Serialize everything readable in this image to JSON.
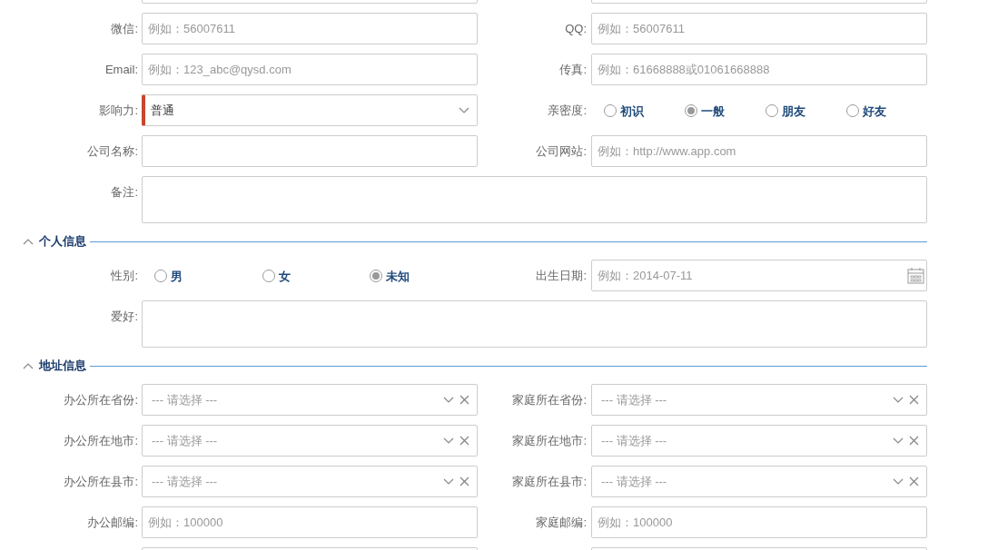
{
  "rows": [
    {
      "kind": "pair",
      "left": {
        "kind": "select"
      },
      "right": {
        "kind": "text"
      }
    },
    {
      "kind": "pair",
      "left": {
        "label": "微信:",
        "kind": "text",
        "placeholder": "例如：56007611"
      },
      "right": {
        "label": "QQ:",
        "kind": "text",
        "placeholder": "例如：56007611"
      }
    },
    {
      "kind": "pair",
      "left": {
        "label": "Email:",
        "kind": "text",
        "placeholder": "例如：123_abc@qysd.com"
      },
      "right": {
        "label": "传真:",
        "kind": "text",
        "placeholder": "例如：61668888或01061668888"
      }
    },
    {
      "kind": "pair",
      "left": {
        "label": "影响力:",
        "kind": "select",
        "value": "普通",
        "required": true
      },
      "right": {
        "label": "亲密度:",
        "kind": "radio",
        "options": [
          {
            "label": "初识",
            "selected": false
          },
          {
            "label": "一般",
            "selected": true
          },
          {
            "label": "朋友",
            "selected": false
          },
          {
            "label": "好友",
            "selected": false
          }
        ]
      }
    },
    {
      "kind": "pair",
      "left": {
        "label": "公司名称:",
        "kind": "text"
      },
      "right": {
        "label": "公司网站:",
        "kind": "text",
        "placeholder": "例如：http://www.app.com"
      }
    },
    {
      "kind": "wide",
      "label": "备注:"
    },
    {
      "kind": "section",
      "title": "个人信息",
      "expanded": true
    },
    {
      "kind": "pair",
      "left": {
        "label": "性别:",
        "kind": "radio",
        "options": [
          {
            "label": "男",
            "selected": false
          },
          {
            "label": "女",
            "selected": false
          },
          {
            "label": "未知",
            "selected": true
          }
        ]
      },
      "right": {
        "label": "出生日期:",
        "kind": "date",
        "placeholder": "例如：2014-07-11"
      }
    },
    {
      "kind": "wide",
      "label": "爱好:"
    },
    {
      "kind": "section",
      "title": "地址信息",
      "expanded": true
    },
    {
      "kind": "pair",
      "left": {
        "label": "办公所在省份:",
        "kind": "select",
        "placeholder": "--- 请选择 ---",
        "clearable": true
      },
      "right": {
        "label": "家庭所在省份:",
        "kind": "select",
        "placeholder": "--- 请选择 ---",
        "clearable": true
      }
    },
    {
      "kind": "pair",
      "left": {
        "label": "办公所在地市:",
        "kind": "select",
        "placeholder": "--- 请选择 ---",
        "clearable": true
      },
      "right": {
        "label": "家庭所在地市:",
        "kind": "select",
        "placeholder": "--- 请选择 ---",
        "clearable": true
      }
    },
    {
      "kind": "pair",
      "left": {
        "label": "办公所在县市:",
        "kind": "select",
        "placeholder": "--- 请选择 ---",
        "clearable": true
      },
      "right": {
        "label": "家庭所在县市:",
        "kind": "select",
        "placeholder": "--- 请选择 ---",
        "clearable": true
      }
    },
    {
      "kind": "pair",
      "left": {
        "label": "办公邮编:",
        "kind": "text",
        "placeholder": "例如：100000"
      },
      "right": {
        "label": "家庭邮编:",
        "kind": "text",
        "placeholder": "例如：100000"
      }
    },
    {
      "kind": "pair",
      "left": {
        "kind": "text"
      },
      "right": {
        "kind": "text"
      }
    }
  ]
}
